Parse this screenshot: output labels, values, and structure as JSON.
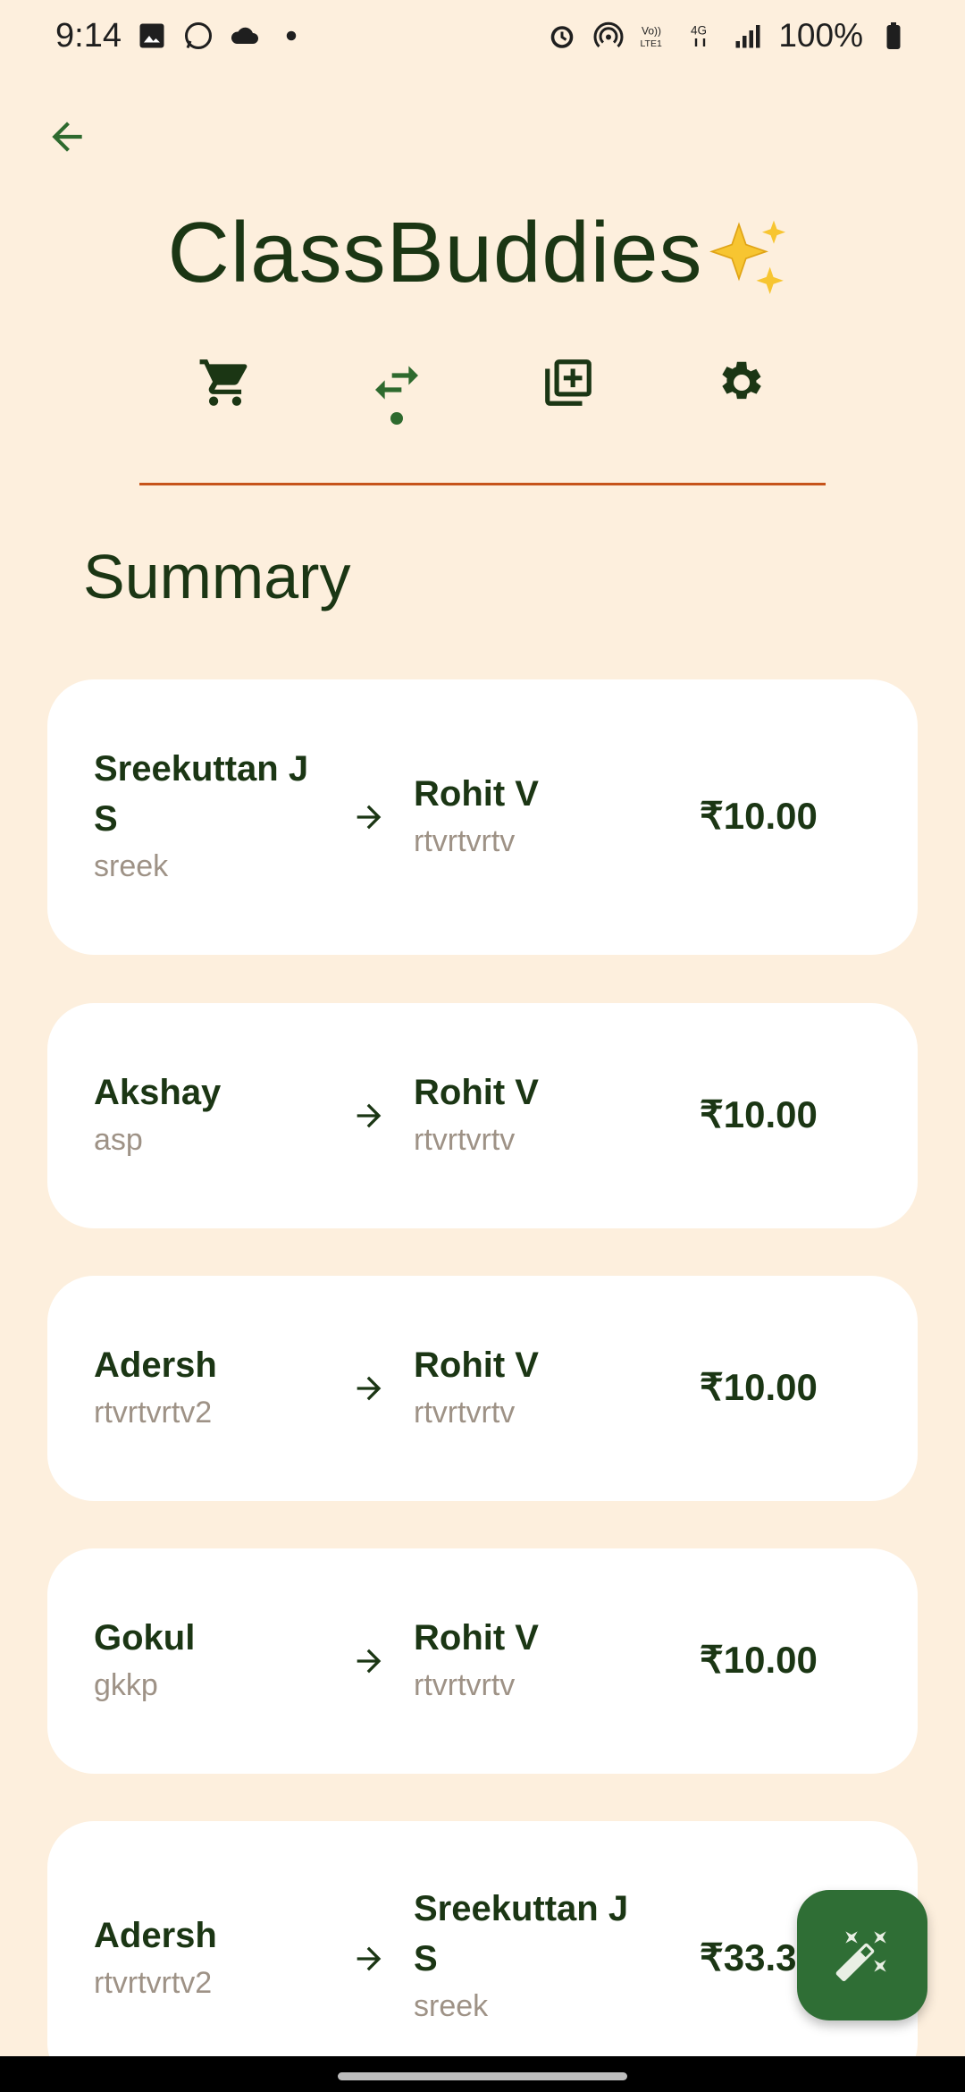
{
  "status_bar": {
    "time": "9:14",
    "battery": "100%"
  },
  "header": {
    "title": "ClassBuddies",
    "back_icon": "arrow-back-icon"
  },
  "tabs": [
    {
      "icon": "cart-icon"
    },
    {
      "icon": "swap-arrows-icon",
      "selected": true
    },
    {
      "icon": "note-add-icon"
    },
    {
      "icon": "gear-icon"
    }
  ],
  "section_title": "Summary",
  "transactions": [
    {
      "from_name": "Sreekuttan J S",
      "from_user": "sreek",
      "to_name": "Rohit V",
      "to_user": "rtvrtvrtv",
      "amount": "₹10.00"
    },
    {
      "from_name": "Akshay",
      "from_user": "asp",
      "to_name": "Rohit V",
      "to_user": "rtvrtvrtv",
      "amount": "₹10.00"
    },
    {
      "from_name": "Adersh",
      "from_user": "rtvrtvrtv2",
      "to_name": "Rohit V",
      "to_user": "rtvrtvrtv",
      "amount": "₹10.00"
    },
    {
      "from_name": "Gokul",
      "from_user": "gkkp",
      "to_name": "Rohit V",
      "to_user": "rtvrtvrtv",
      "amount": "₹10.00"
    },
    {
      "from_name": "Adersh",
      "from_user": "rtvrtvrtv2",
      "to_name": "Sreekuttan J S",
      "to_user": "sreek",
      "amount": "₹33.33"
    }
  ],
  "colors": {
    "background": "#fdefdd",
    "primary": "#2e6a2e",
    "text": "#1b3614",
    "divider": "#c6531a",
    "muted": "#9e9286"
  },
  "fab": {
    "icon": "magic-wand-icon"
  }
}
